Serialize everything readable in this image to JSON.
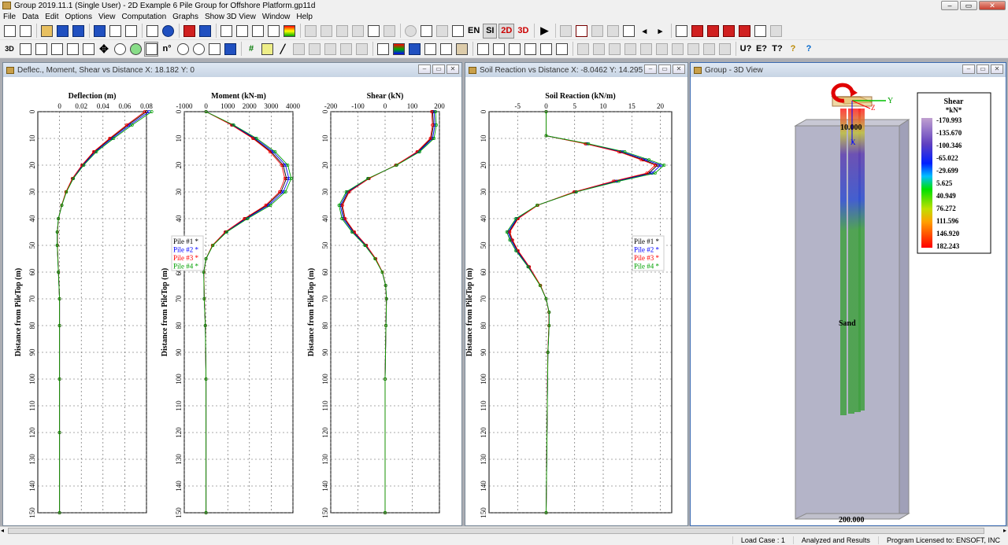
{
  "app": {
    "title": "Group 2019.11.1 (Single User) - 2D Example 6 Pile Group for Offshore Platform.gp11d"
  },
  "menu": [
    "File",
    "Data",
    "Edit",
    "Options",
    "View",
    "Computation",
    "Graphs",
    "Show 3D View",
    "Window",
    "Help"
  ],
  "toolbar": {
    "en_label": "EN",
    "si_label": "SI",
    "twod_label": "2D",
    "threed_label": "3D",
    "view3d_label": "3D"
  },
  "windows": {
    "dms": {
      "title": "Deflec., Moment, Shear  vs Distance X: 18.182 Y: 0",
      "footer": "Load Case 1"
    },
    "soil": {
      "title": "Soil Reaction vs Distance X: -8.0462 Y: 14.295",
      "footer": "Load Case 1"
    },
    "view3d": {
      "title": "Group - 3D View"
    }
  },
  "legend": [
    "Pile #1 *",
    "Pile #2 *",
    "Pile #3 *",
    "Pile #4 *"
  ],
  "colors": {
    "pile1": "#000000",
    "pile2": "#0000ff",
    "pile3": "#ff0000",
    "pile4": "#00a000"
  },
  "view3d": {
    "top_label": "10.000",
    "bottom_label": "200.000",
    "soil_label": "Sand",
    "axis_y": "Y",
    "axis_x": "X",
    "axis_z": "Z",
    "colorbar": {
      "title": "Shear",
      "unit": "*kN*",
      "values": [
        "-170.993",
        "-135.670",
        "-100.346",
        "-65.022",
        "-29.699",
        "5.625",
        "40.949",
        "76.272",
        "111.596",
        "146.920",
        "182.243"
      ]
    }
  },
  "status": {
    "load_case": "Load Case : 1",
    "state": "Analyzed and Results",
    "license": "Program Licensed to: ENSOFT, INC"
  },
  "chart_data": [
    {
      "type": "line",
      "title": "Deflection (m)",
      "ylabel": "Distance from PileTop (m)",
      "xlim": [
        -0.02,
        0.08
      ],
      "ylim": [
        0,
        150
      ],
      "xticks": [
        "0",
        "0.02",
        "0.04",
        "0.06",
        "0.08"
      ],
      "series": [
        {
          "name": "Pile #1",
          "y": [
            0,
            5,
            10,
            15,
            20,
            25,
            30,
            35,
            40,
            45,
            50,
            60,
            70,
            80,
            100,
            120,
            150
          ],
          "x": [
            0.08,
            0.063,
            0.047,
            0.032,
            0.021,
            0.012,
            0.006,
            0.002,
            -0.001,
            -0.002,
            -0.002,
            -0.001,
            0,
            0,
            0,
            0,
            0
          ]
        }
      ]
    },
    {
      "type": "line",
      "title": "Moment (kN-m)",
      "ylabel": "Distance from PileTop (m)",
      "xlim": [
        -1000,
        4000
      ],
      "ylim": [
        0,
        150
      ],
      "xticks": [
        "-1000",
        "0",
        "1000",
        "2000",
        "3000",
        "4000"
      ],
      "series": [
        {
          "name": "Pile #1",
          "y": [
            0,
            5,
            10,
            15,
            20,
            25,
            30,
            35,
            40,
            45,
            50,
            55,
            60,
            70,
            80,
            100,
            150
          ],
          "x": [
            0,
            1200,
            2200,
            3000,
            3550,
            3700,
            3450,
            2800,
            1800,
            900,
            300,
            0,
            -100,
            -80,
            -30,
            0,
            0
          ]
        }
      ]
    },
    {
      "type": "line",
      "title": "Shear (kN)",
      "ylabel": "Distance from PileTop (m)",
      "xlim": [
        -200,
        200
      ],
      "ylim": [
        0,
        150
      ],
      "xticks": [
        "-200",
        "-100",
        "0",
        "100",
        "200"
      ],
      "series": [
        {
          "name": "Pile #1",
          "y": [
            0,
            5,
            10,
            15,
            20,
            25,
            30,
            35,
            40,
            45,
            50,
            55,
            60,
            65,
            70,
            80,
            100,
            150
          ],
          "x": [
            175,
            178,
            170,
            120,
            40,
            -60,
            -135,
            -160,
            -150,
            -115,
            -70,
            -35,
            -10,
            2,
            5,
            3,
            0,
            0
          ]
        }
      ]
    },
    {
      "type": "line",
      "title": "Soil Reaction (kN/m)",
      "ylabel": "Distance from PileTop (m)",
      "xlim": [
        -10,
        22
      ],
      "ylim": [
        0,
        150
      ],
      "xticks": [
        "-5",
        "0",
        "5",
        "10",
        "15",
        "20"
      ],
      "series": [
        {
          "name": "Pile #1",
          "y": [
            0,
            9,
            12,
            15,
            18,
            20,
            23,
            26,
            30,
            35,
            40,
            45,
            48,
            52,
            58,
            65,
            70,
            75,
            80,
            90,
            150
          ],
          "x": [
            0,
            0,
            7,
            13,
            17,
            19.5,
            18,
            12,
            5,
            -1.5,
            -5,
            -6.5,
            -6,
            -5,
            -3,
            -1,
            0,
            0.5,
            0.5,
            0.3,
            0
          ]
        }
      ]
    }
  ]
}
